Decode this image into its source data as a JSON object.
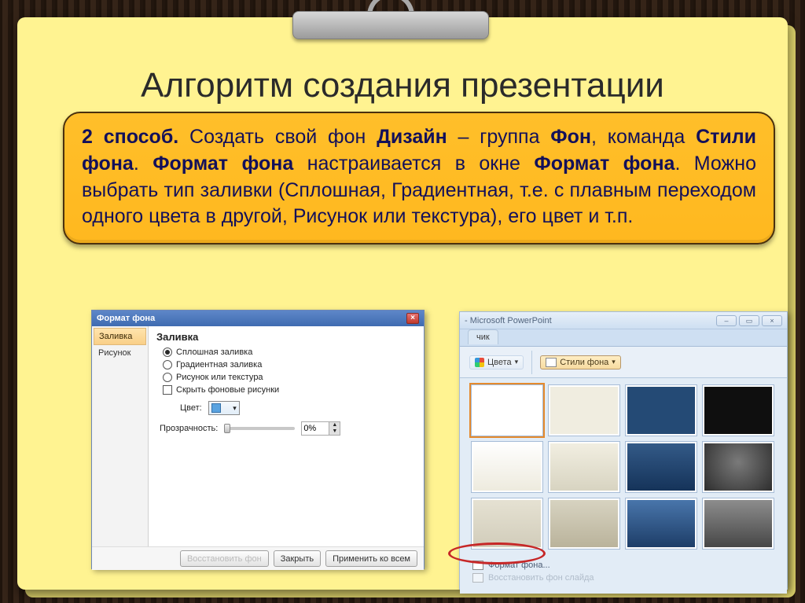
{
  "slide": {
    "title": "Алгоритм создания презентации",
    "body_html": "<b>2 способ.</b> Создать свой фон <b>Дизайн</b> – группа <b>Фон</b>, команда <b>Стили фона</b>. <b>Формат фона</b> настраивается в окне <b>Формат фона</b>. Можно выбрать тип заливки (Сплошная, Градиентная, т.е. с плавным переходом одного цвета в другой, Рисунок или текстура), его цвет и т.п."
  },
  "dlg": {
    "title": "Формат фона",
    "tabs": {
      "fill": "Заливка",
      "picture": "Рисунок"
    },
    "panel_title": "Заливка",
    "radios": {
      "solid": "Сплошная заливка",
      "gradient": "Градиентная заливка",
      "texture": "Рисунок или текстура"
    },
    "hide_bg": "Скрыть фоновые рисунки",
    "color_label": "Цвет:",
    "opacity_label": "Прозрачность:",
    "opacity_value": "0%",
    "buttons": {
      "restore": "Восстановить фон",
      "close": "Закрыть",
      "apply_all": "Применить ко всем"
    }
  },
  "pp": {
    "app_title": "- Microsoft PowerPoint",
    "tab": "чик",
    "colors_btn": "Цвета",
    "styles_btn": "Стили фона",
    "footer": {
      "format": "Формат фона...",
      "reset": "Восстановить фон слайда"
    },
    "swatches": [
      "#ffffff",
      "#f0ede0",
      "#244a75",
      "#0f0f0f",
      "linear-gradient(#ffffff,#edeadd)",
      "linear-gradient(#f2efe2,#d7d3c0)",
      "linear-gradient(#345b89,#143258)",
      "radial-gradient(circle at 50% 40%, #7a7a7a, #2a2a2a)",
      "linear-gradient(#e6e2d3,#d1ccba)",
      "linear-gradient(#d8d4c2,#b9b29a)",
      "linear-gradient(#4a77ad,#1c3c66)",
      "linear-gradient(#8f8f8f,#454545)"
    ]
  }
}
